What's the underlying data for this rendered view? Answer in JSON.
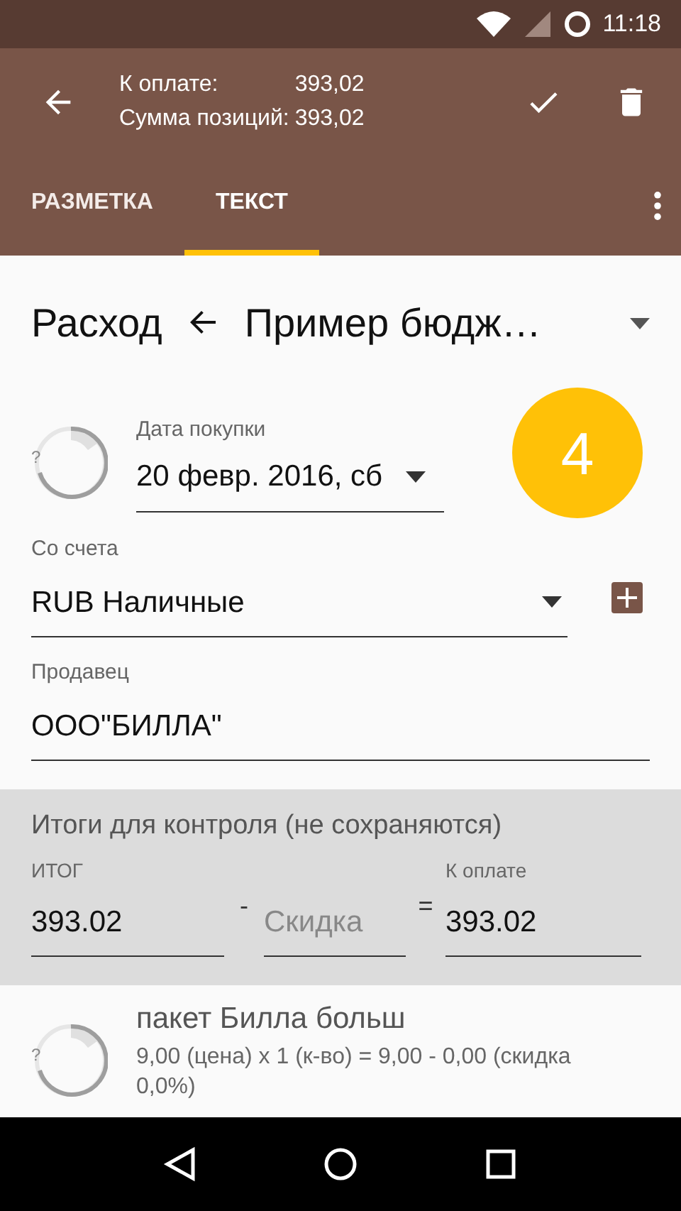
{
  "status_bar": {
    "time": "11:18"
  },
  "app_bar": {
    "summary": [
      {
        "label": "К оплате:",
        "value": "393,02"
      },
      {
        "label": "Сумма позиций:",
        "value": "393,02"
      }
    ]
  },
  "tabs": [
    {
      "label": "РАЗМЕТКА",
      "selected": false
    },
    {
      "label": "ТЕКСТ",
      "selected": true
    }
  ],
  "header": {
    "type": "Расход",
    "budget": "Пример бюдж…"
  },
  "date": {
    "label": "Дата покупки",
    "value": "20 февр. 2016, сб",
    "ring_mark": "?"
  },
  "badge": "4",
  "account": {
    "label": "Со счета",
    "value": "RUB Наличные"
  },
  "seller": {
    "label": "Продавец",
    "value": "ООО\"БИЛЛА\""
  },
  "totals": {
    "title": "Итоги для контроля (не сохраняются)",
    "total_label": "ИТОГ",
    "total": "393.02",
    "minus": "-",
    "discount_placeholder": "Скидка",
    "equals": "=",
    "pay_label": "К оплате",
    "pay": "393.02"
  },
  "items": [
    {
      "ring_mark": "?",
      "name": "пакет Билла больш",
      "details": "9,00 (цена) x 1 (к-во) = 9,00 - 0,00 (скидка 0,0%)"
    }
  ]
}
